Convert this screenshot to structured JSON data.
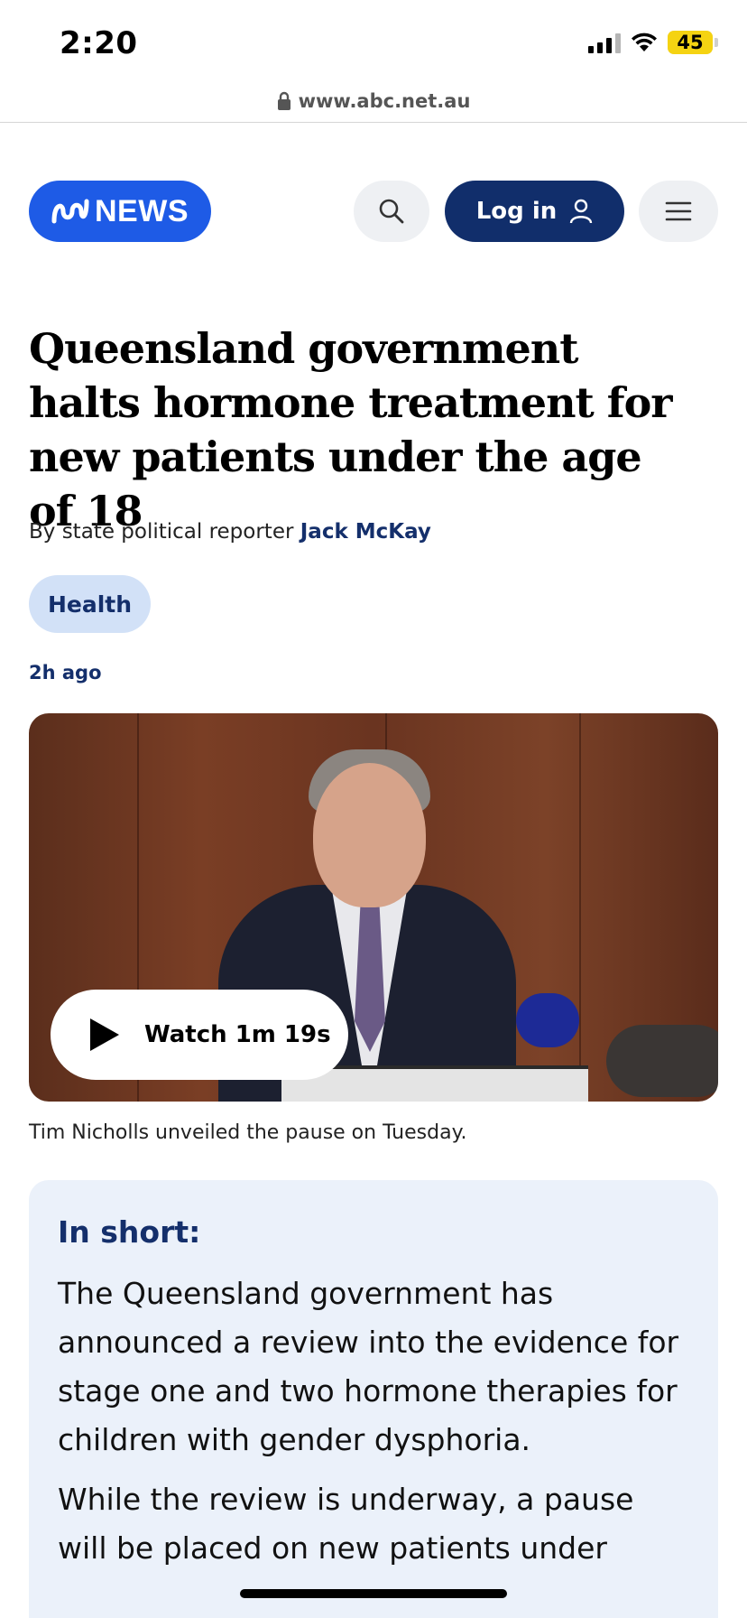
{
  "status_bar": {
    "time": "2:20",
    "battery_level": "45",
    "battery_color": "#f5d312"
  },
  "url_bar": {
    "url": "www.abc.net.au"
  },
  "header": {
    "logo_text": "NEWS",
    "login_label": "Log in",
    "brand_color": "#1e5be6",
    "login_color": "#112e6b"
  },
  "article": {
    "headline": "Queensland government halts hormone treatment for new patients under the age of 18",
    "byline_prefix": "By state political reporter",
    "author": "Jack McKay",
    "tag": "Health",
    "time_ago": "2h ago",
    "video_button": "Watch 1m 19s",
    "caption": "Tim Nicholls unveiled the pause on Tuesday.",
    "in_short": {
      "title": "In short:",
      "paragraphs": [
        "The Queensland government has announced a review into the evidence for stage one and two hormone therapies for children with gender dysphoria.",
        "While the review is underway, a pause will be placed on new patients under"
      ]
    }
  }
}
